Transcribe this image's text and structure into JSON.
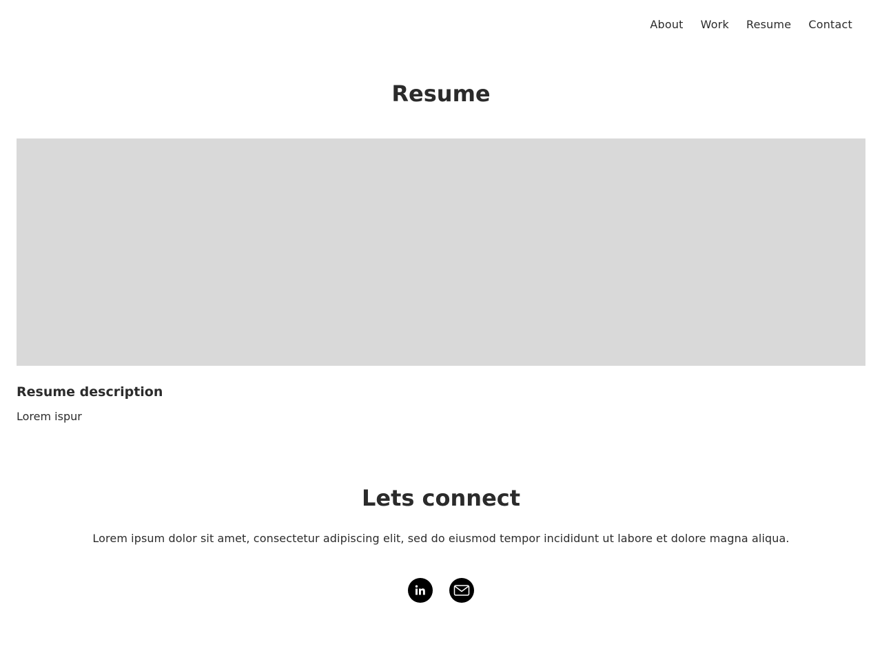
{
  "nav": {
    "items": [
      {
        "label": "About"
      },
      {
        "label": "Work"
      },
      {
        "label": "Resume"
      },
      {
        "label": "Contact"
      }
    ]
  },
  "page": {
    "title": "Resume"
  },
  "resume": {
    "description_title": "Resume description",
    "description_text": "Lorem ispur"
  },
  "connect": {
    "title": "Lets connect",
    "text": "Lorem ipsum dolor sit amet, consectetur adipiscing elit, sed do eiusmod tempor incididunt ut labore et dolore magna aliqua."
  },
  "social": {
    "icons": [
      "linkedin-icon",
      "mail-icon"
    ]
  },
  "colors": {
    "text": "#2b2b2b",
    "placeholder": "#d9d9d9",
    "icon_bg": "#000000"
  }
}
